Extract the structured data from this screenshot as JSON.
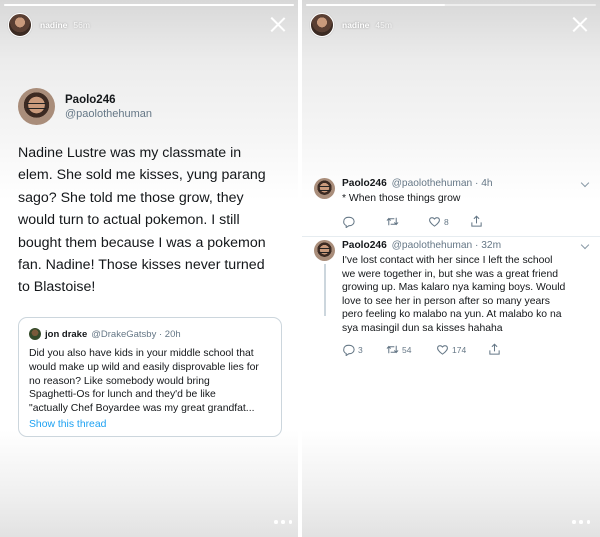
{
  "left_story": {
    "username": "nadine",
    "time": "56m"
  },
  "right_story": {
    "username": "nadine",
    "time": "45m"
  },
  "main_tweet": {
    "author_name": "Paolo246",
    "author_handle": "@paolothehuman",
    "text": "Nadine Lustre was my classmate in\nelem. She sold me kisses, yung parang\nsago? She told me those grow, they\nwould turn to actual pokemon. I still\nbought them because I was a pokemon\nfan. Nadine! Those kisses never turned\nto Blastoise!"
  },
  "quoted_tweet": {
    "author_name": "jon drake",
    "author_handle": "@DrakeGatsby",
    "time": "20h",
    "text": "Did you also have kids in your middle school that\nwould make up wild and easily disprovable lies for\nno reason? Like somebody would bring\nSpaghetti-Os for lunch and they'd be like\n\"actually Chef Boyardee was my great grandfat...",
    "link_label": "Show this thread"
  },
  "replies": [
    {
      "author_name": "Paolo246",
      "author_handle": "@paolothehuman",
      "time": "4h",
      "text": "* When those things grow",
      "reply_count": "",
      "retweet_count": "",
      "like_count": "8"
    },
    {
      "author_name": "Paolo246",
      "author_handle": "@paolothehuman",
      "time": "32m",
      "text": "I've lost contact with her since I left the school\nwe were together in, but she was a great friend\ngrowing up. Mas kalaro nya kaming boys. Would\nlove to see her in person after so many years\npero feeling ko malabo na yun. At malabo ko na\nsya masingil dun sa kisses hahaha",
      "reply_count": "3",
      "retweet_count": "54",
      "like_count": "174"
    }
  ],
  "icons": [
    "close-icon",
    "more-icon",
    "reply-icon",
    "retweet-icon",
    "like-icon",
    "share-icon",
    "chevron-down-icon"
  ],
  "colors": {
    "link_blue": "#1da1f2",
    "secondary_gray": "#657786",
    "border_gray": "#ccd6dd"
  }
}
